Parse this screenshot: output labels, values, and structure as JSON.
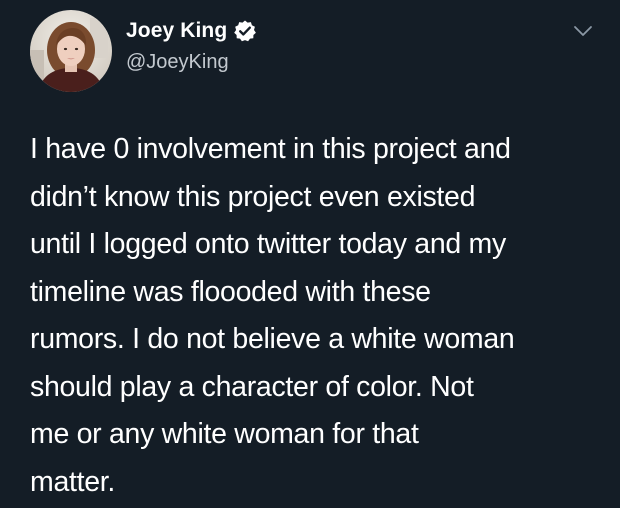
{
  "author": {
    "display_name": "Joey King",
    "handle": "@JoeyKing",
    "verified": true,
    "verified_icon": "verified-badge-icon",
    "avatar_icon": "avatar-photo"
  },
  "menu": {
    "icon": "chevron-down-icon"
  },
  "tweet": {
    "lines": [
      "I have 0 involvement in this project and",
      "didn’t know this project even existed",
      "until I logged onto twitter today and my",
      "timeline was floooded with these",
      "rumors. I do not believe a white woman",
      "should play a character of color. Not",
      "me or any white woman for that",
      "matter."
    ]
  },
  "colors": {
    "background": "#141d26",
    "text": "#ffffff",
    "secondary_text": "#c3c9cf",
    "icon": "#8b98a5"
  }
}
